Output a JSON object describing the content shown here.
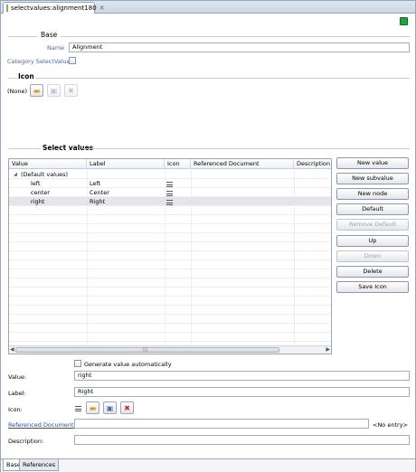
{
  "editor_tab": {
    "title": "selectvalues:alignment180",
    "close": "✕"
  },
  "base": {
    "section_title": "Base",
    "name_label": "Name",
    "name_value": "Alignment",
    "category_label": "Category SelectValue"
  },
  "icon_section": {
    "title": "Icon",
    "current": "(None)"
  },
  "select_values": {
    "title": "Select values",
    "columns": [
      "Value",
      "Label",
      "Icon",
      "Referenced Document",
      "Description"
    ],
    "group_row": "(Default values)",
    "rows": [
      {
        "value": "left",
        "label": "Left"
      },
      {
        "value": "center",
        "label": "Center"
      },
      {
        "value": "right",
        "label": "Right"
      }
    ]
  },
  "buttons": {
    "new_value": "New value",
    "new_subvalue": "New subvalue",
    "new_node": "New node",
    "default": "Default",
    "remove_default": "Remove Default",
    "up": "Up",
    "down": "Down",
    "delete": "Delete",
    "save_icon": "Save Icon"
  },
  "details": {
    "generate_label": "Generate value automatically",
    "value_label": "Value:",
    "value": "right",
    "label_label": "Label:",
    "label": "Right",
    "icon_label": "Icon:",
    "ref_doc_label": "Referenced Document:",
    "ref_doc_value": "<No entry>",
    "description_label": "Description:"
  },
  "bottom_tabs": [
    "Base",
    "References"
  ],
  "colors": {
    "status_green": "#1fa33a",
    "link_blue": "#1d4fa5",
    "label_blue": "#4a66a0"
  }
}
